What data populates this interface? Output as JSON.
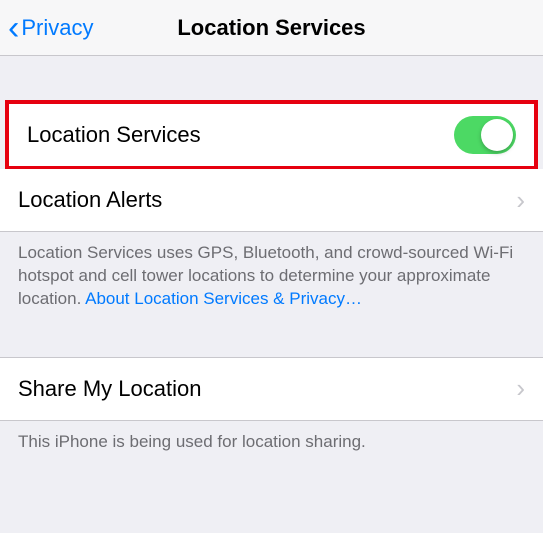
{
  "nav": {
    "back_label": "Privacy",
    "title": "Location Services"
  },
  "rows": {
    "location_services": {
      "label": "Location Services"
    },
    "location_alerts": {
      "label": "Location Alerts"
    },
    "share_my_location": {
      "label": "Share My Location"
    }
  },
  "footers": {
    "services_desc": "Location Services uses GPS, Bluetooth, and crowd-sourced Wi-Fi hotspot and cell tower locations to determine your approximate location. ",
    "services_link": "About Location Services & Privacy…",
    "share_desc": "This iPhone is being used for location sharing."
  }
}
